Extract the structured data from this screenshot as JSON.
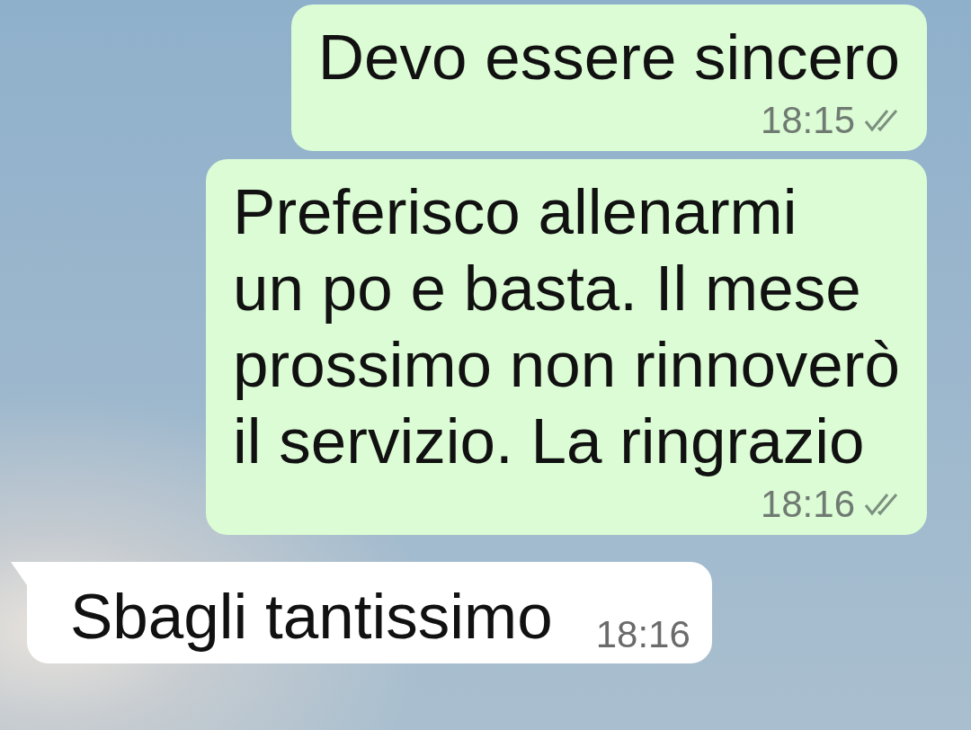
{
  "messages": [
    {
      "kind": "outgoing",
      "text": "Devo essere sincero",
      "time": "18:15",
      "delivered": true
    },
    {
      "kind": "outgoing",
      "text": "Preferisco allenarmi\nun po e basta. Il mese\nprossimo non rinnoverò\nil servizio. La ringrazio",
      "time": "18:16",
      "delivered": true
    },
    {
      "kind": "incoming",
      "text": "Sbagli tantissimo",
      "time": "18:16",
      "tail": true
    }
  ]
}
